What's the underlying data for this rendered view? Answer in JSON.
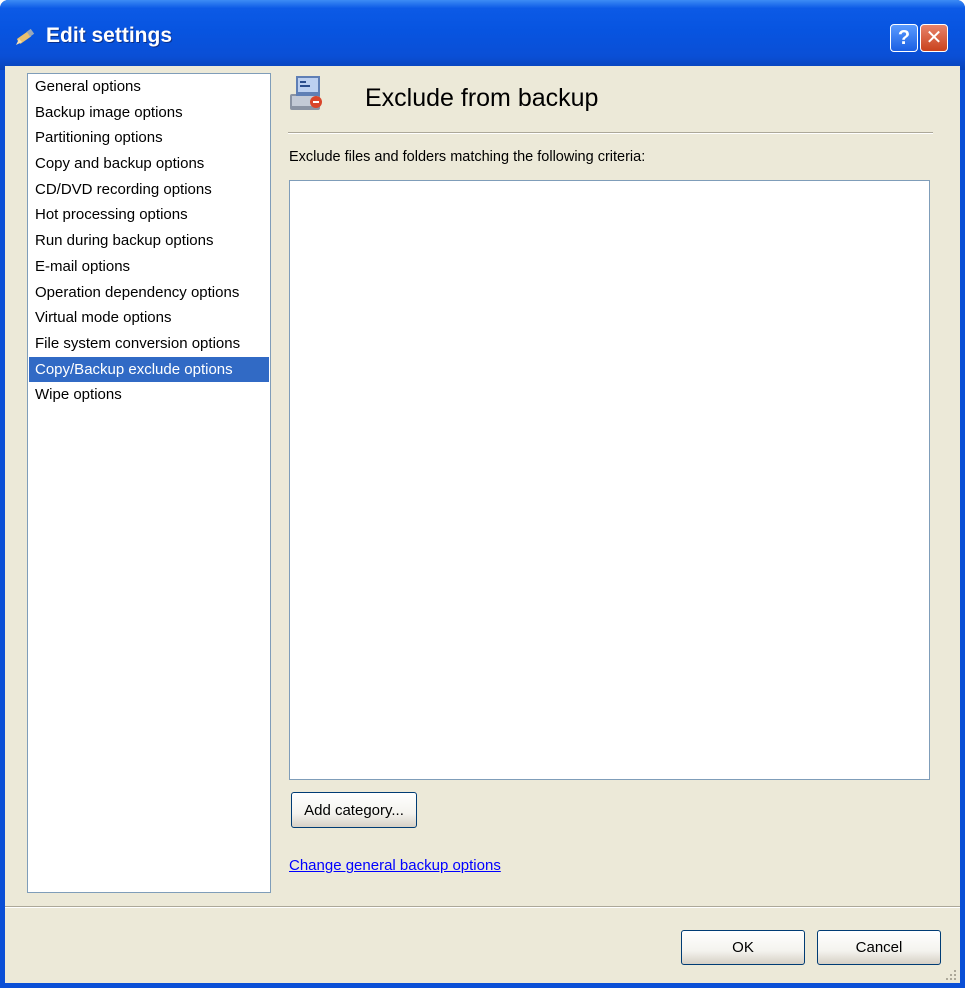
{
  "window": {
    "title": "Edit settings",
    "help_glyph": "?",
    "close_glyph": "✕"
  },
  "sidebar": {
    "items": [
      {
        "label": "General options"
      },
      {
        "label": "Backup image options"
      },
      {
        "label": "Partitioning options"
      },
      {
        "label": "Copy and backup options"
      },
      {
        "label": "CD/DVD recording options"
      },
      {
        "label": "Hot processing options"
      },
      {
        "label": "Run during backup options"
      },
      {
        "label": "E-mail options"
      },
      {
        "label": "Operation dependency options"
      },
      {
        "label": "Virtual mode options"
      },
      {
        "label": "File system conversion options"
      },
      {
        "label": "Copy/Backup exclude options"
      },
      {
        "label": "Wipe options"
      }
    ],
    "selected_label": "Copy/Backup exclude options"
  },
  "main": {
    "title": "Exclude from backup",
    "criteria_label": "Exclude files and folders matching the following criteria:",
    "add_category_label": "Add category...",
    "change_link_label": "Change general backup options"
  },
  "footer": {
    "ok_label": "OK",
    "cancel_label": "Cancel"
  },
  "colors": {
    "titlebar": "#0a4fd6",
    "selection": "#316ac5",
    "dialog_bg": "#ece9d8",
    "link": "#0000ff"
  },
  "icons": {
    "title": "settings-pencil-icon",
    "header": "backup-exclude-icon",
    "help": "help-icon",
    "close": "close-icon"
  }
}
